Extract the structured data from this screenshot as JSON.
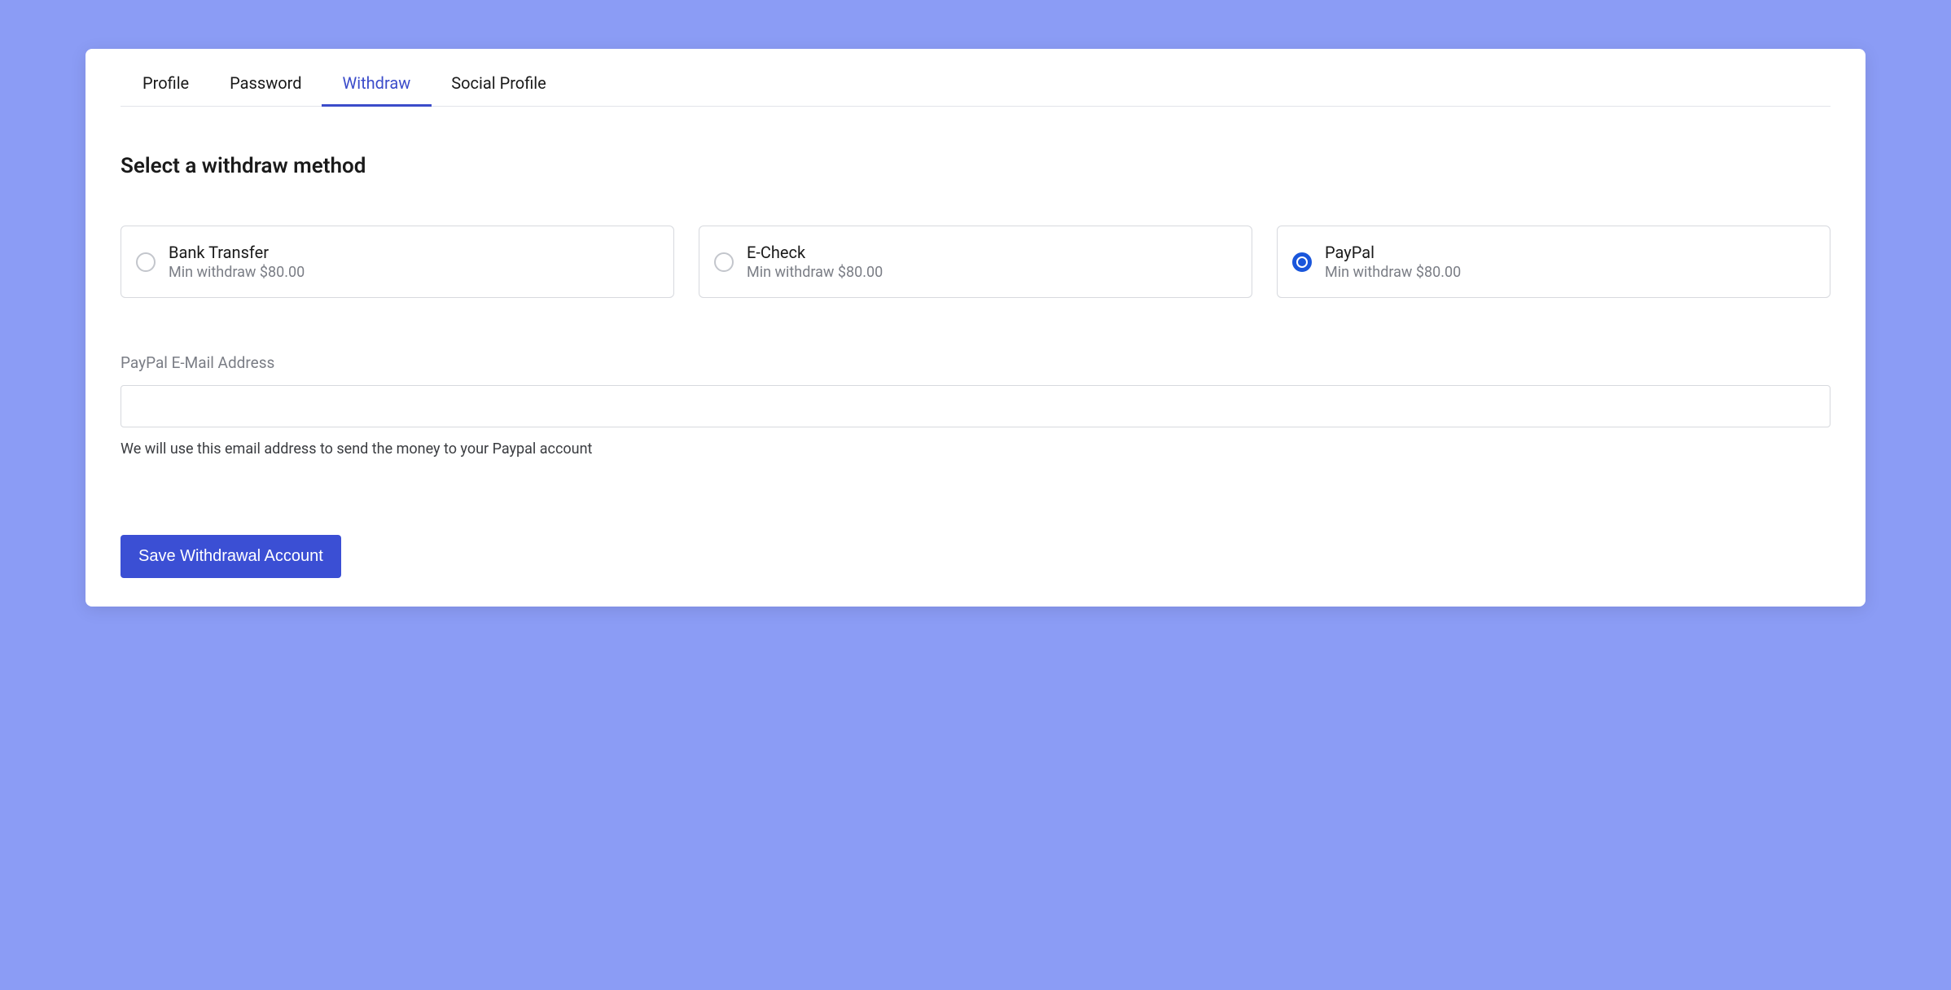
{
  "tabs": [
    {
      "label": "Profile",
      "active": false
    },
    {
      "label": "Password",
      "active": false
    },
    {
      "label": "Withdraw",
      "active": true
    },
    {
      "label": "Social Profile",
      "active": false
    }
  ],
  "section_title": "Select a withdraw method",
  "methods": [
    {
      "name": "Bank Transfer",
      "subtitle": "Min withdraw $80.00",
      "selected": false
    },
    {
      "name": "E-Check",
      "subtitle": "Min withdraw $80.00",
      "selected": false
    },
    {
      "name": "PayPal",
      "subtitle": "Min withdraw $80.00",
      "selected": true
    }
  ],
  "email_field": {
    "label": "PayPal E-Mail Address",
    "value": "",
    "helper": "We will use this email address to send the money to your Paypal account"
  },
  "save_button_label": "Save Withdrawal Account"
}
